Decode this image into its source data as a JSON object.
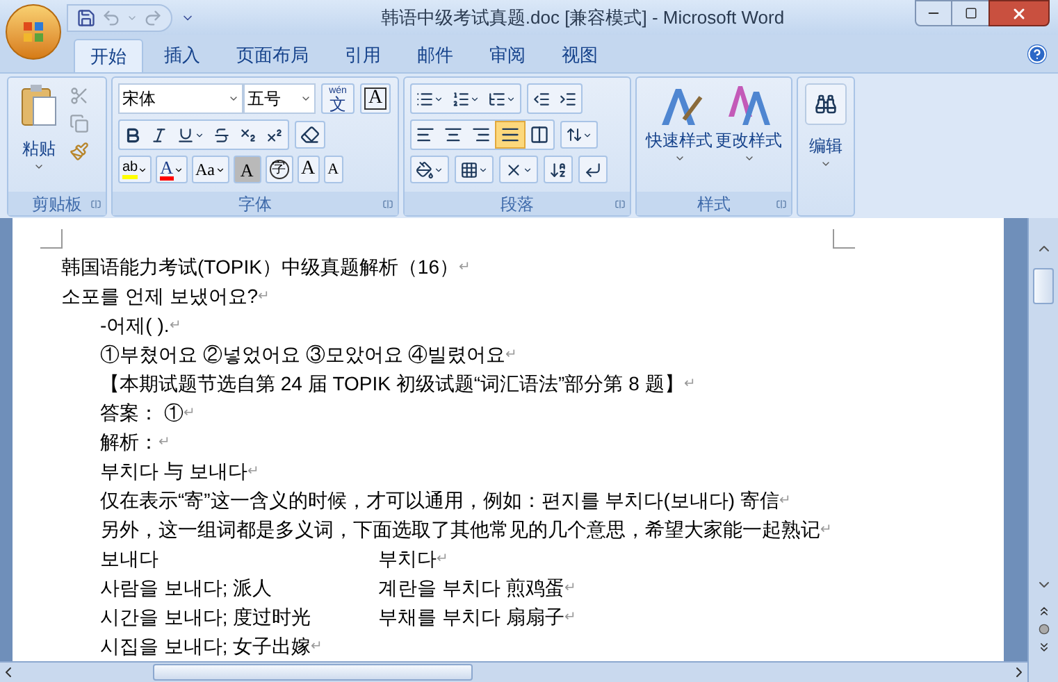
{
  "window": {
    "title": "韩语中级考试真题.doc [兼容模式] - Microsoft Word"
  },
  "tabs": [
    {
      "label": "开始",
      "selected": true
    },
    {
      "label": "插入",
      "selected": false
    },
    {
      "label": "页面布局",
      "selected": false
    },
    {
      "label": "引用",
      "selected": false
    },
    {
      "label": "邮件",
      "selected": false
    },
    {
      "label": "审阅",
      "selected": false
    },
    {
      "label": "视图",
      "selected": false
    }
  ],
  "clipboard": {
    "label": "剪贴板",
    "paste": "粘贴"
  },
  "font": {
    "label": "字体",
    "font_name": "宋体",
    "font_size": "五号",
    "phonetic_top": "wén",
    "phonetic_main": "文",
    "char_border": "A",
    "highlight": "ab",
    "font_color": "A",
    "change_case": "Aa",
    "char_shading": "A",
    "enclose": "字",
    "grow": "A",
    "shrink": "A"
  },
  "paragraph": {
    "label": "段落",
    "alignments": [
      {
        "kind": "left",
        "selected": false
      },
      {
        "kind": "center",
        "selected": false
      },
      {
        "kind": "right",
        "selected": false
      },
      {
        "kind": "justify",
        "selected": true
      },
      {
        "kind": "distributed",
        "selected": false
      }
    ]
  },
  "styles": {
    "label": "样式",
    "quick_styles": "快速样式",
    "change_styles": "更改样式"
  },
  "editing": {
    "label": "编辑"
  },
  "document": {
    "lines": [
      {
        "text": "韩国语能力考试(TOPIK）中级真题解析（16）",
        "indented": false,
        "mark": "↵"
      },
      {
        "text": "소포를 언제 보냈어요?",
        "indented": false,
        "mark": "↵"
      },
      {
        "text": "-어제( ).",
        "indented": true,
        "mark": "↵"
      },
      {
        "text": "①부쳤어요 ②넣었어요 ③모았어요 ④빌렸어요",
        "indented": true,
        "mark": "↵"
      },
      {
        "text": "【本期试题节选自第 24 届 TOPIK 初级试题“词汇语法”部分第 8 题】",
        "indented": true,
        "mark": "↵"
      },
      {
        "text": "答案： ①",
        "indented": true,
        "mark": "↵"
      },
      {
        "text": "解析：",
        "indented": true,
        "mark": "↵"
      },
      {
        "text": "부치다 与 보내다",
        "indented": true,
        "mark": "↵"
      },
      {
        "text": "仅在表示“寄”这一含义的时候，才可以通用，例如：편지를 부치다(보내다) 寄信",
        "indented": true,
        "mark": "↵"
      },
      {
        "text": "另外，这一组词都是多义词，下面选取了其他常见的几个意思，希望大家能一起熟记",
        "indented": true,
        "mark": "↵"
      },
      {
        "cells": [
          "보내다",
          "부치다"
        ],
        "indented": true,
        "mark": "↵"
      },
      {
        "cells": [
          "사람을 보내다; 派人",
          "계란을 부치다 煎鸡蛋"
        ],
        "indented": true,
        "mark": "↵"
      },
      {
        "cells": [
          "시간을 보내다; 度过时光",
          "부채를 부치다 扇扇子"
        ],
        "indented": true,
        "mark": "↵"
      },
      {
        "text": "시집을 보내다; 女子出嫁",
        "indented": true,
        "mark": "↵"
      }
    ]
  }
}
